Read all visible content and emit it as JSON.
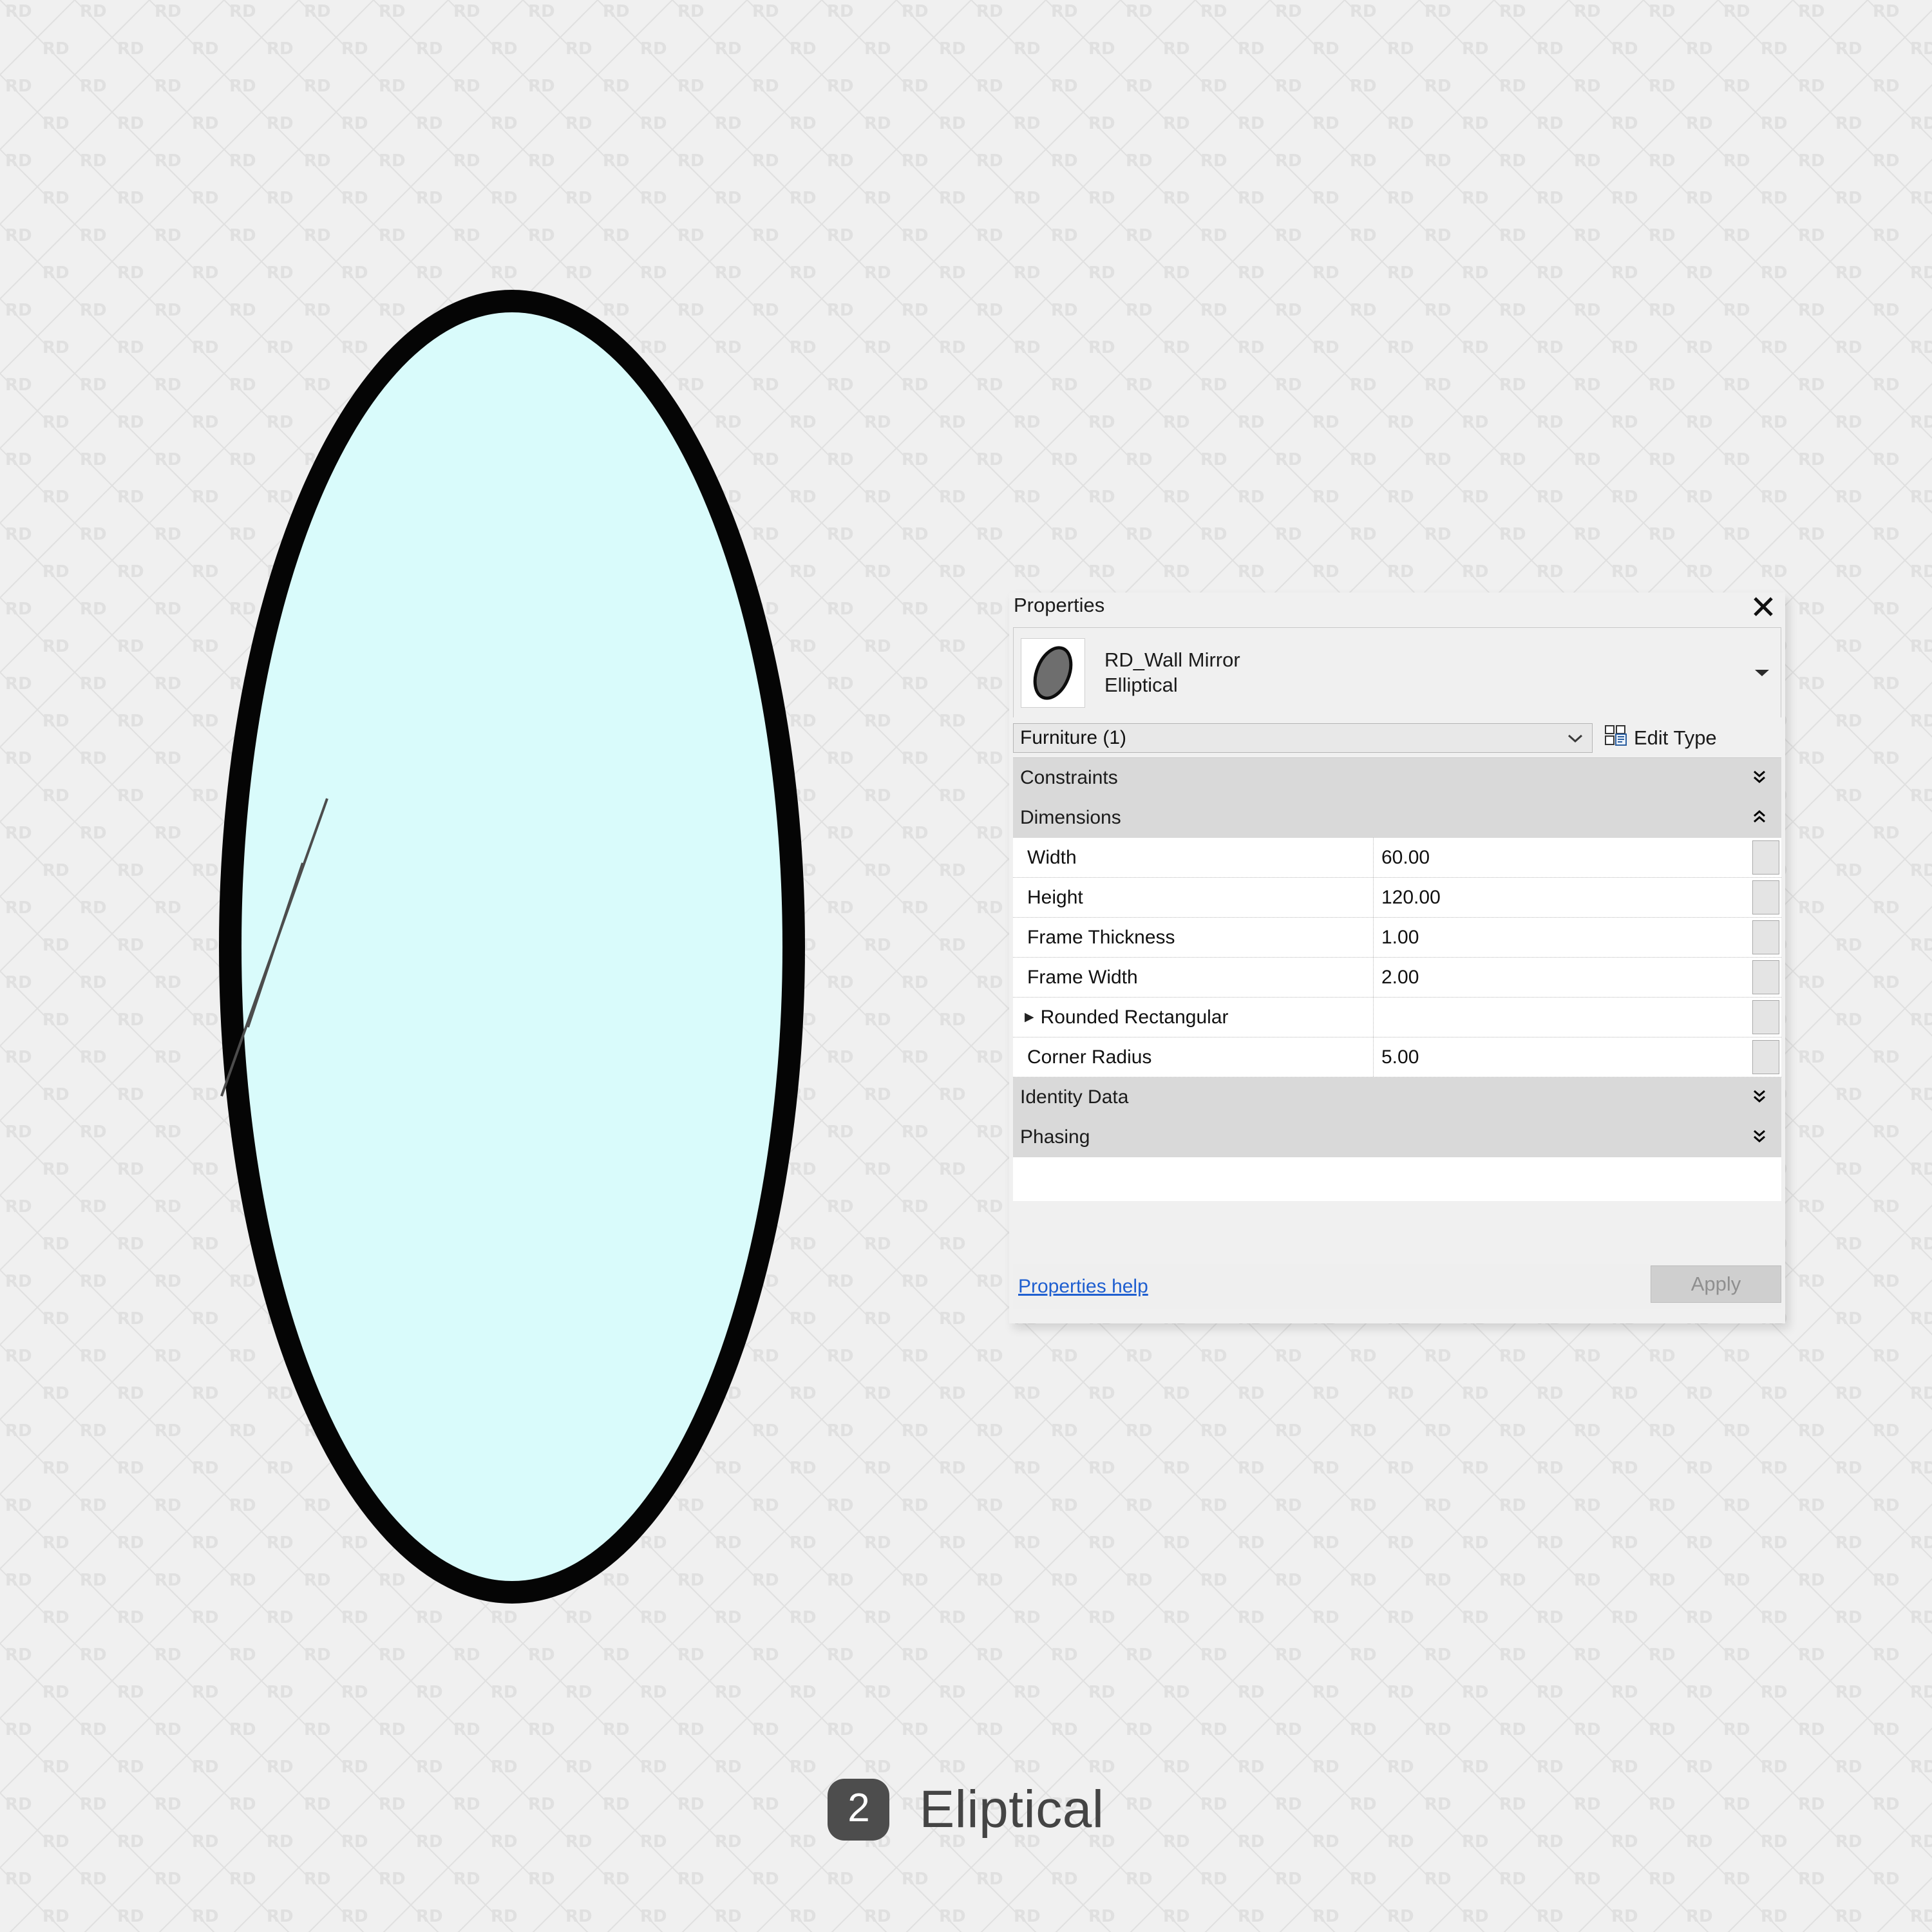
{
  "background": {
    "watermark_text": "RD",
    "base_color": "#f0f0f0",
    "watermark_color": "#e0e0e0"
  },
  "drawing": {
    "shape": "ellipse",
    "frame_color": "#000000",
    "glass_color": "#d9fbfb",
    "reflection_lines": 2
  },
  "caption": {
    "badge_number": "2",
    "label": "Eliptical",
    "badge_color": "#4d4d4d",
    "text_color": "#444444"
  },
  "properties_panel": {
    "title": "Properties",
    "close_icon": "close-icon",
    "type_preview": {
      "family_name": "RD_Wall Mirror",
      "type_name": "Elliptical",
      "dropdown_icon": "chevron-down-icon"
    },
    "category_selector": {
      "value": "Furniture (1)",
      "dropdown_icon": "chevron-down-icon"
    },
    "edit_type": {
      "label": "Edit Type",
      "icon": "edit-type-icon"
    },
    "groups": [
      {
        "name": "Constraints",
        "collapsed": true,
        "chevron": "»",
        "rows": []
      },
      {
        "name": "Dimensions",
        "collapsed": false,
        "chevron": "«",
        "rows": [
          {
            "name": "Width",
            "value": "60.00",
            "sub": false
          },
          {
            "name": "Height",
            "value": "120.00",
            "sub": false
          },
          {
            "name": "Frame Thickness",
            "value": "1.00",
            "sub": false
          },
          {
            "name": "Frame Width",
            "value": "2.00",
            "sub": false
          },
          {
            "name": "Rounded Rectangular",
            "value": "",
            "sub": true
          },
          {
            "name": "Corner Radius",
            "value": "5.00",
            "sub": false
          }
        ]
      },
      {
        "name": "Identity Data",
        "collapsed": true,
        "chevron": "»",
        "rows": []
      },
      {
        "name": "Phasing",
        "collapsed": true,
        "chevron": "»",
        "rows": []
      }
    ],
    "footer": {
      "help_link": "Properties help",
      "apply_label": "Apply",
      "apply_enabled": false
    }
  }
}
